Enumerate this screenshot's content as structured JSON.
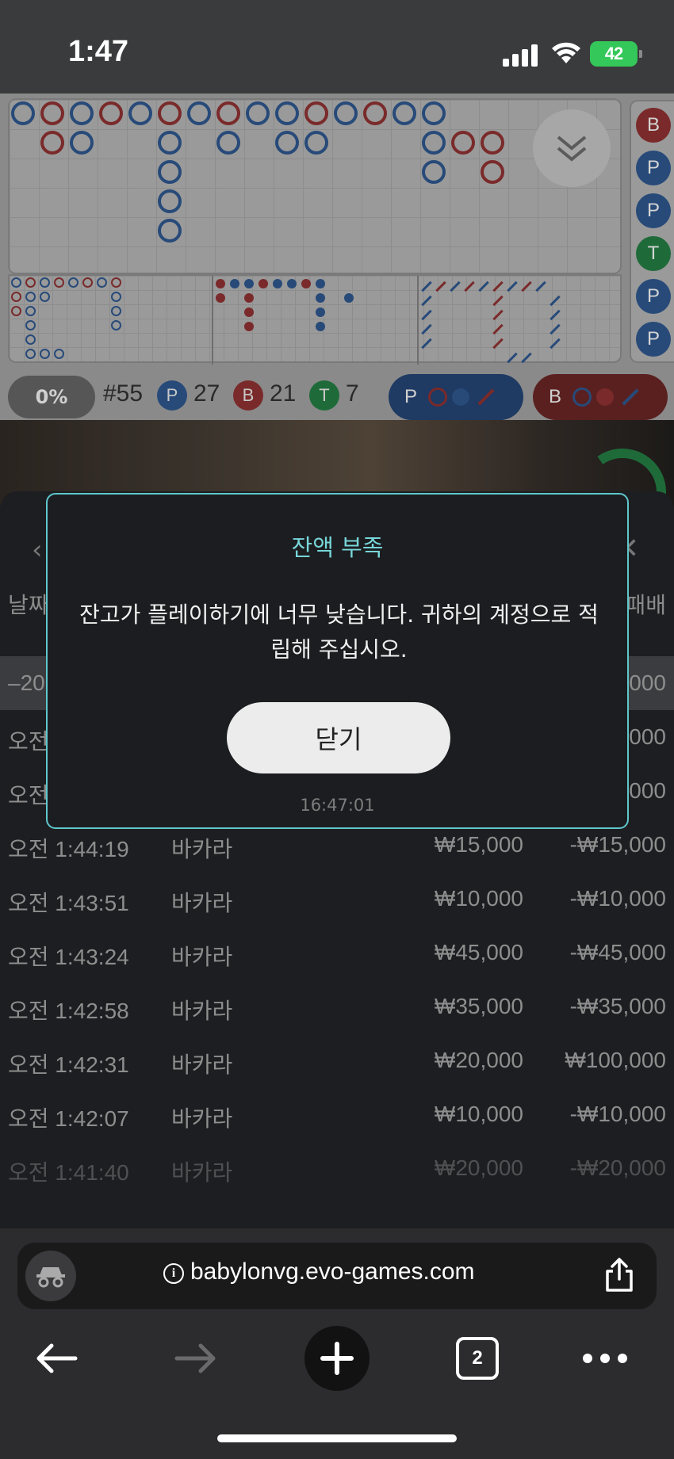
{
  "status_bar": {
    "time": "1:47",
    "battery": "42"
  },
  "roadmap": {
    "round": "#55",
    "percent": "0%",
    "player_label": "P",
    "player_count": "27",
    "banker_label": "B",
    "banker_count": "21",
    "tie_label": "T",
    "tie_count": "7",
    "player_ask": "P",
    "banker_ask": "B",
    "side_labels": [
      "B",
      "P",
      "P",
      "T",
      "P",
      "P"
    ]
  },
  "history": {
    "columns": {
      "date": "날짜",
      "payout": "패배"
    },
    "highlight_row": {
      "time": "–20",
      "payout": "000"
    },
    "partial_rows": [
      {
        "time": "오전",
        "payout": "000"
      },
      {
        "time": "오전",
        "payout": "000"
      }
    ],
    "rows": [
      {
        "time": "오전 1:44:19",
        "game": "바카라",
        "bet": "₩15,000",
        "result": "-₩15,000"
      },
      {
        "time": "오전 1:43:51",
        "game": "바카라",
        "bet": "₩10,000",
        "result": "-₩10,000"
      },
      {
        "time": "오전 1:43:24",
        "game": "바카라",
        "bet": "₩45,000",
        "result": "-₩45,000"
      },
      {
        "time": "오전 1:42:58",
        "game": "바카라",
        "bet": "₩35,000",
        "result": "-₩35,000"
      },
      {
        "time": "오전 1:42:31",
        "game": "바카라",
        "bet": "₩20,000",
        "result": "₩100,000"
      },
      {
        "time": "오전 1:42:07",
        "game": "바카라",
        "bet": "₩10,000",
        "result": "-₩10,000"
      },
      {
        "time": "오전 1:41:40",
        "game": "바카라",
        "bet": "₩20,000",
        "result": "-₩20,000"
      }
    ]
  },
  "modal": {
    "title": "잔액 부족",
    "message": "잔고가 플레이하기에 너무 낮습니다. 귀하의 계정으로 적립해 주십시오.",
    "button": "닫기",
    "timestamp": "16:47:01"
  },
  "browser": {
    "url": "babylonvg.evo-games.com",
    "tab_count": "2"
  },
  "colors": {
    "accent": "#5fc7cc",
    "player": "#274a79",
    "banker": "#7a2a2a",
    "tie": "#1e6b39"
  }
}
